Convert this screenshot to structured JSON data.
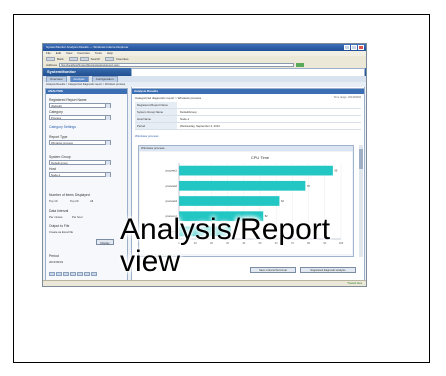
{
  "window": {
    "title": "SystemMonitor Analysis Results — Windows Internet Explorer"
  },
  "menu": [
    "File",
    "Edit",
    "View",
    "Favorites",
    "Tools",
    "Help"
  ],
  "toolbar": {
    "back": "Back",
    "search": "Search",
    "favorites": "Favorites"
  },
  "address": {
    "label": "Address",
    "value": "http://localhost/SystemMonitor/analysis/report.aspx"
  },
  "app": {
    "name": "SystemMonitor",
    "user": "Help"
  },
  "tabs": [
    "Overview",
    "Analysis",
    "Configuration"
  ],
  "active_tab": 1,
  "breadcrumb": "Analysis Results > Categorized diagnostic report > Windows process",
  "left_panel": {
    "title": "ANALYSIS",
    "fields": [
      {
        "label": "Registered Report Name",
        "value": "(Default)"
      },
      {
        "label": "Category",
        "value": "Process"
      },
      {
        "label": "Report Type",
        "value": "Windows process"
      },
      {
        "label": "System Group",
        "value": "Default group"
      },
      {
        "label": "Host",
        "value": "Node-1"
      }
    ],
    "category_settings": "Category Settings",
    "radio_group_label": "Number of items Displayed",
    "radio_options": [
      "Top 10",
      "Top 20",
      "All"
    ],
    "interval_label": "Data Interval",
    "interval_options": [
      "Per minute",
      "Per hour"
    ],
    "output_label": "Output to File",
    "output_option": "Create as Excel file",
    "display_button": "Display",
    "period_label": "Period",
    "period_value": "2013/09/04"
  },
  "right_panel": {
    "title": "Analysis Results",
    "report_title": "Categorized diagnostic report > Windows process",
    "report_meta": "Time range: 2013/09/04",
    "info_rows": [
      {
        "key": "Registered Report Name",
        "value": ""
      },
      {
        "key": "System Group Name",
        "value": "DefaultGroup"
      },
      {
        "key": "Host Name",
        "value": "Node-1"
      },
      {
        "key": "Period",
        "value": "Wednesday, September 4, 2013"
      }
    ],
    "link": "Windows process",
    "chart_section": "Windows process",
    "footer_buttons": [
      "Save in Excel file format",
      "Registered diagnostic analysis"
    ]
  },
  "status": {
    "zone": "Trusted sites"
  },
  "overlay": {
    "line1": "Analysis/Report",
    "line2": "view"
  },
  "chart_data": {
    "type": "bar",
    "orientation": "horizontal",
    "title": "CPU Time",
    "categories": [
      "process1",
      "process2",
      "process3",
      "process4",
      "process5"
    ],
    "values": [
      95,
      78,
      62,
      52,
      32
    ],
    "xlabel": "",
    "ylabel": "",
    "xlim": [
      0,
      100
    ],
    "color": "#22c7c4"
  }
}
